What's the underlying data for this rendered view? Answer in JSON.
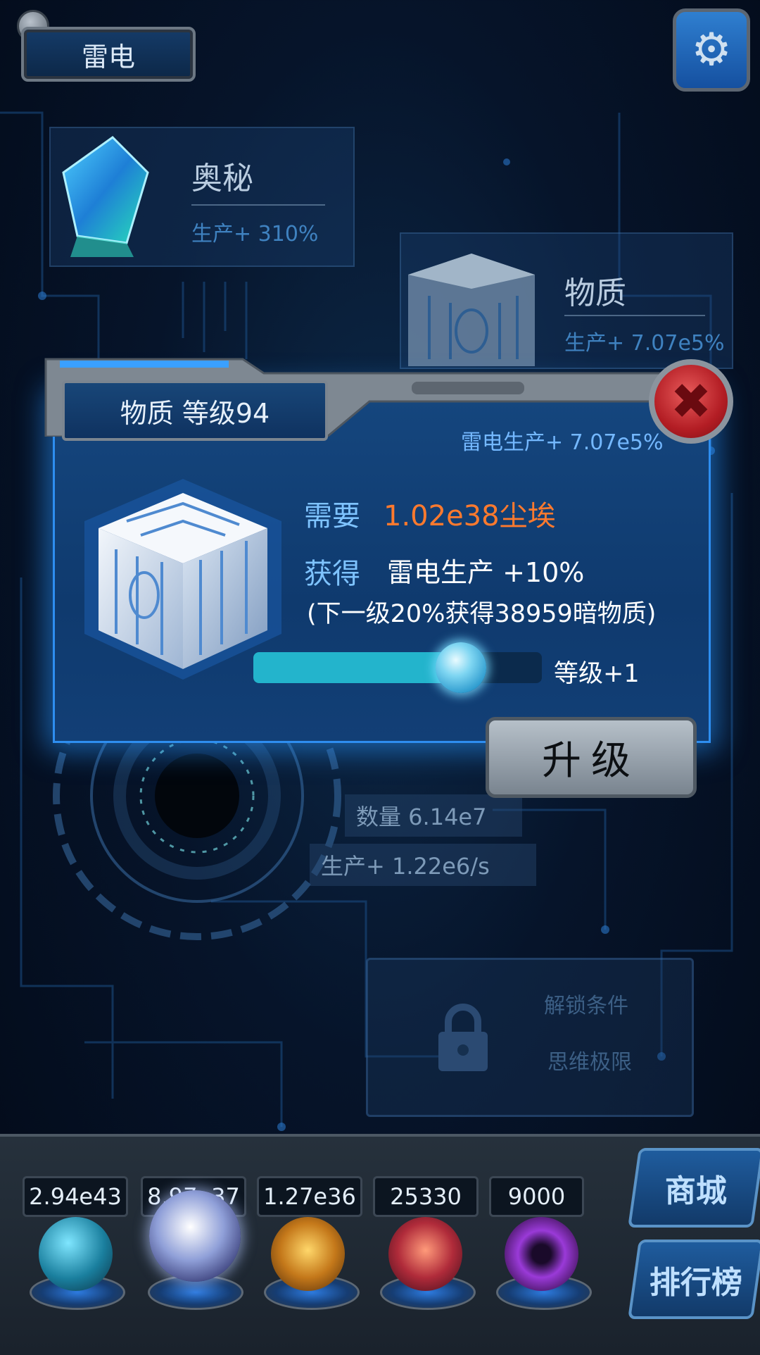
{
  "header": {
    "title": "雷电"
  },
  "background_cards": {
    "mystery": {
      "name": "奥秘",
      "production": "生产+ 310%"
    },
    "matter": {
      "name": "物质",
      "production": "生产+ 7.07e5%"
    },
    "thunder": {
      "name": "雷电",
      "quantity": "数量 6.14e7",
      "production": "生产+ 1.22e6/s"
    }
  },
  "locked_panel": {
    "condition_label": "解锁条件",
    "condition_value": "思维极限"
  },
  "modal": {
    "title": "物质 等级94",
    "production_line": "雷电生产+ 7.07e5%",
    "need_label": "需要",
    "need_value": "1.02e38尘埃",
    "gain_label": "获得",
    "gain_value": "雷电生产 +10%",
    "next_line": "(下一级20%获得38959暗物质)",
    "slider_fraction": 0.72,
    "level_label": "等级+1",
    "upgrade_label": "升级"
  },
  "resources": [
    "2.94e43",
    "8.97e37",
    "1.27e36",
    "25330",
    "9000"
  ],
  "side_buttons": {
    "shop": "商城",
    "ranking": "排行榜"
  },
  "colors": {
    "accent": "#2e8ef0",
    "need_value": "#ff7a2e",
    "slider": "#23b4cc",
    "close": "#c8232b"
  },
  "icons": [
    "gear-icon",
    "close-icon",
    "lock-icon",
    "crystal-icon",
    "cube-icon"
  ]
}
